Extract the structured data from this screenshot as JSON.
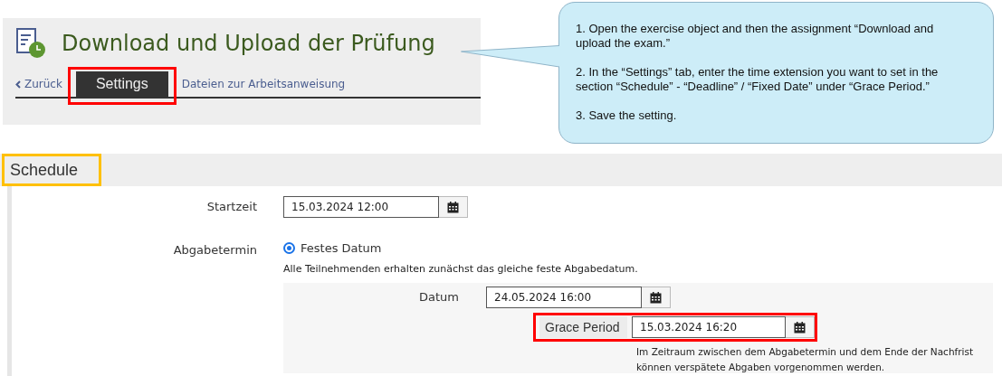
{
  "header": {
    "title": "Download und Upload der Prüfung",
    "back_link": "Zurück",
    "tabs": [
      {
        "label": "Settings",
        "selected": true,
        "highlight": {
          "color": "#ff0000"
        }
      },
      {
        "label": "Dateien zur Arbeitsanweisung",
        "selected": false
      }
    ]
  },
  "callout": {
    "steps": [
      "1. Open the exercise object and then the assignment “Download and upload the exam.”",
      "2. In the “Settings” tab, enter the time extension you want to set in the section “Schedule” - “Deadline” / “Fixed Date” under “Grace Period.”",
      "3. Save the setting."
    ]
  },
  "section": {
    "title": "Schedule",
    "highlight": {
      "color": "#ffc000"
    }
  },
  "start": {
    "label": "Startzeit",
    "value": "15.03.2024 12:00"
  },
  "deadline": {
    "label": "Abgabetermin",
    "option": {
      "label": "Festes Datum",
      "selected": true
    },
    "description": "Alle Teilnehmenden erhalten zunächst das gleiche feste Abgabedatum.",
    "date": {
      "label": "Datum",
      "value": "24.05.2024 16:00"
    },
    "grace": {
      "label": "Grace Period",
      "value": "15.03.2024 16:20",
      "highlight": {
        "color": "#ff0000"
      },
      "help": "Im Zeitraum zwischen dem Abgabetermin und dem Ende der Nachfrist können verspätete Abgaben vorgenommen werden."
    }
  }
}
